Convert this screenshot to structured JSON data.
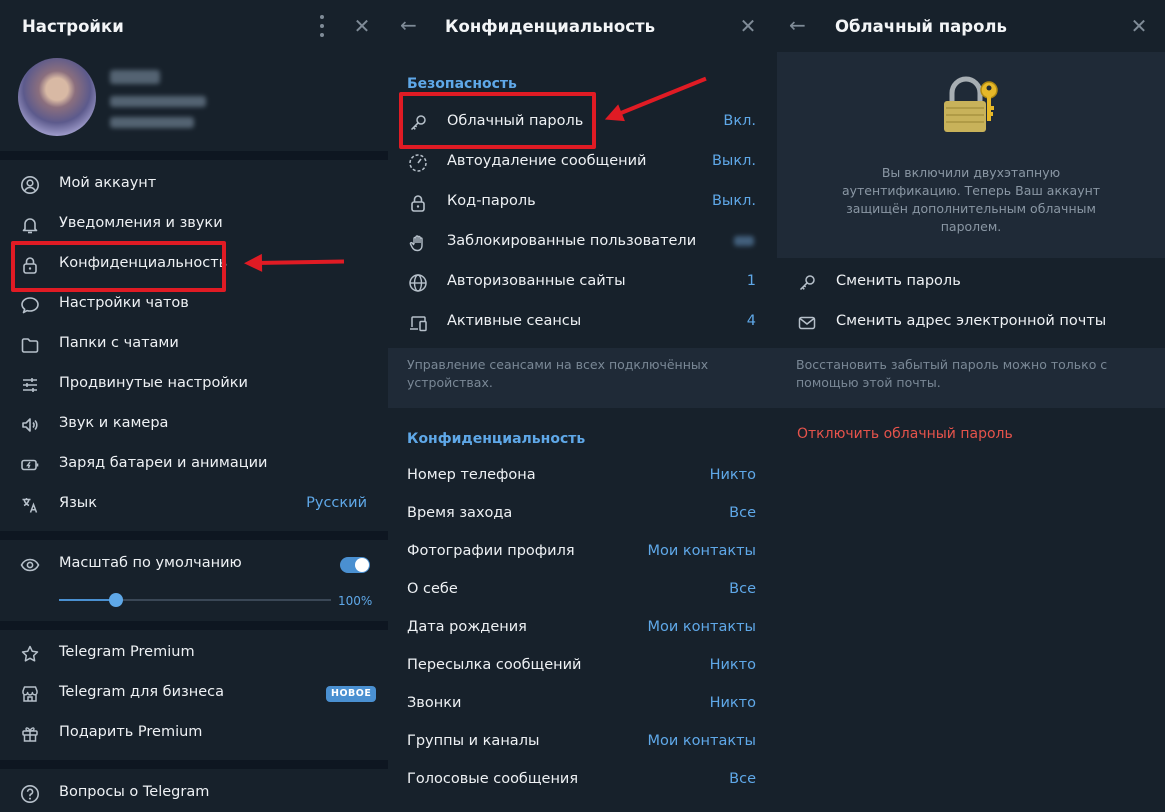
{
  "left": {
    "title": "Настройки",
    "menu": [
      {
        "icon": "user-circle-icon",
        "label": "Мой аккаунт"
      },
      {
        "icon": "bell-icon",
        "label": "Уведомления и звуки"
      },
      {
        "icon": "lock-icon",
        "label": "Конфиденциальность"
      },
      {
        "icon": "chat-bubble-icon",
        "label": "Настройки чатов"
      },
      {
        "icon": "folder-icon",
        "label": "Папки с чатами"
      },
      {
        "icon": "sliders-icon",
        "label": "Продвинутые настройки"
      },
      {
        "icon": "speaker-icon",
        "label": "Звук и камера"
      },
      {
        "icon": "battery-icon",
        "label": "Заряд батареи и анимации"
      },
      {
        "icon": "translate-icon",
        "label": "Язык",
        "value": "Русский"
      }
    ],
    "scale": {
      "label": "Масштаб по умолчанию",
      "value": "100%",
      "enabled": true,
      "slider_fraction": 0.21
    },
    "premium": [
      {
        "icon": "star-icon",
        "label": "Telegram Premium"
      },
      {
        "icon": "shop-icon",
        "label": "Telegram для бизнеса",
        "badge": "НОВОЕ"
      },
      {
        "icon": "gift-icon",
        "label": "Подарить Premium"
      }
    ],
    "faq": {
      "icon": "question-icon",
      "label": "Вопросы о Telegram"
    }
  },
  "middle": {
    "title": "Конфиденциальность",
    "security_title": "Безопасность",
    "security": [
      {
        "icon": "key-icon",
        "label": "Облачный пароль",
        "value": "Вкл."
      },
      {
        "icon": "timer-icon",
        "label": "Автоудаление сообщений",
        "value": "Выкл."
      },
      {
        "icon": "lock-icon",
        "label": "Код-пароль",
        "value": "Выкл."
      },
      {
        "icon": "hand-icon",
        "label": "Заблокированные пользователи",
        "value": ""
      },
      {
        "icon": "globe-icon",
        "label": "Авторизованные сайты",
        "value": "1"
      },
      {
        "icon": "devices-icon",
        "label": "Активные сеансы",
        "value": "4"
      }
    ],
    "sessions_hint": "Управление сеансами на всех подключённых устройствах.",
    "privacy_title": "Конфиденциальность",
    "privacy": [
      {
        "label": "Номер телефона",
        "value": "Никто"
      },
      {
        "label": "Время захода",
        "value": "Все"
      },
      {
        "label": "Фотографии профиля",
        "value": "Мои контакты"
      },
      {
        "label": "О себе",
        "value": "Все"
      },
      {
        "label": "Дата рождения",
        "value": "Мои контакты"
      },
      {
        "label": "Пересылка сообщений",
        "value": "Никто"
      },
      {
        "label": "Звонки",
        "value": "Никто"
      },
      {
        "label": "Группы и каналы",
        "value": "Мои контакты"
      },
      {
        "label": "Голосовые сообщения",
        "value": "Все"
      }
    ]
  },
  "right": {
    "title": "Облачный пароль",
    "twofa_text": "Вы включили двухэтапную аутентификацию. Теперь Ваш аккаунт защищён дополнительным облачным паролем.",
    "actions": [
      {
        "icon": "key-icon",
        "label": "Сменить пароль"
      },
      {
        "icon": "mail-icon",
        "label": "Сменить адрес электронной почты"
      }
    ],
    "recovery_hint": "Восстановить забытый пароль можно только с помощью этой почты.",
    "disable_label": "Отключить облачный пароль"
  },
  "colors": {
    "accent": "#5fa8e8",
    "danger": "#e5534b",
    "annotation": "#e01b24",
    "background": "#17212b"
  }
}
